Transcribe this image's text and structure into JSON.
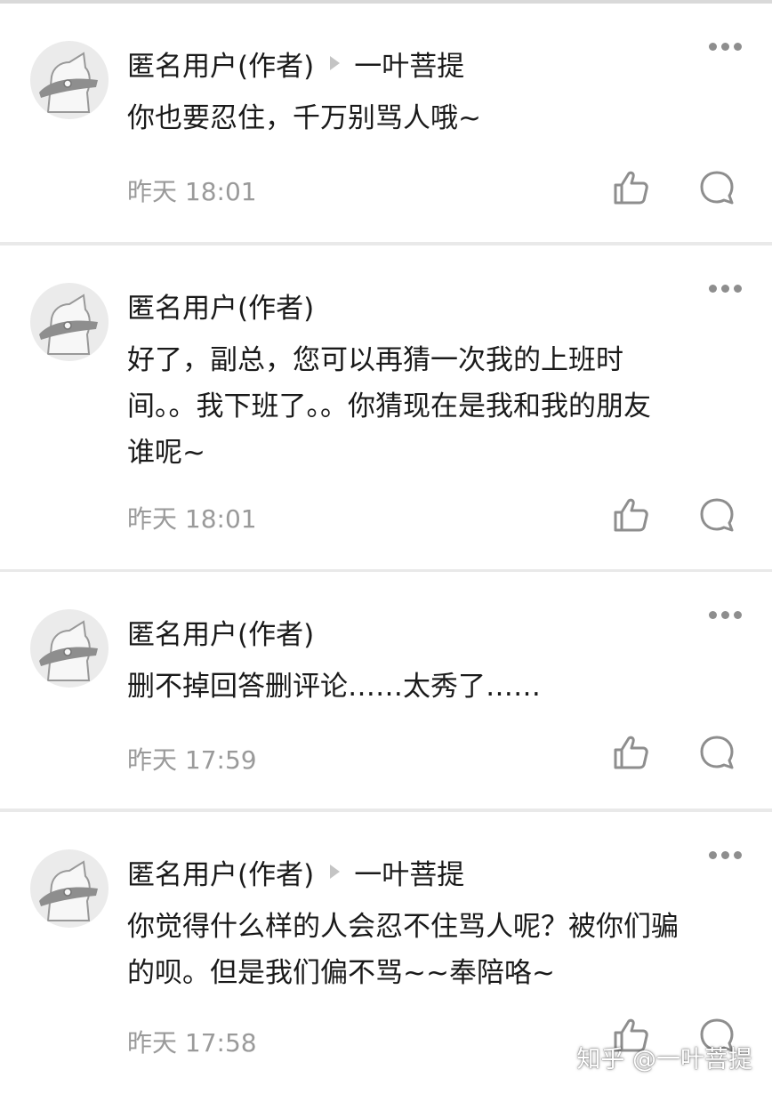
{
  "comments": [
    {
      "author": "匿名用户(作者)",
      "reply_to": "一叶菩提",
      "lines": [
        "你也要忍住，千万别骂人哦~"
      ],
      "time": "昨天 18:01"
    },
    {
      "author": "匿名用户(作者)",
      "reply_to": "",
      "lines": [
        "好了，副总，您可以再猜一次我的上班时",
        "间。。我下班了。。你猜现在是我和我的朋友",
        "谁呢~"
      ],
      "time": "昨天 18:01"
    },
    {
      "author": "匿名用户(作者)",
      "reply_to": "",
      "lines": [
        "删不掉回答删评论……太秀了……"
      ],
      "time": "昨天 17:59"
    },
    {
      "author": "匿名用户(作者)",
      "reply_to": "一叶菩提",
      "lines": [
        "你觉得什么样的人会忍不住骂人呢？被你们骗",
        "的呗。但是我们偏不骂~~奉陪咯~"
      ],
      "time": "昨天 17:58"
    }
  ],
  "icons": {
    "avatar": "anonymous-cat-icon",
    "more": "more-dots-icon",
    "like": "thumbs-up-icon",
    "reply": "comment-bubble-icon"
  },
  "watermark": "知乎 @一叶菩提",
  "colors": {
    "background": "#e9e9e9",
    "card": "#ffffff",
    "text": "#1a1a1a",
    "time": "#9a9a9a",
    "icon": "#8e8e8e"
  }
}
